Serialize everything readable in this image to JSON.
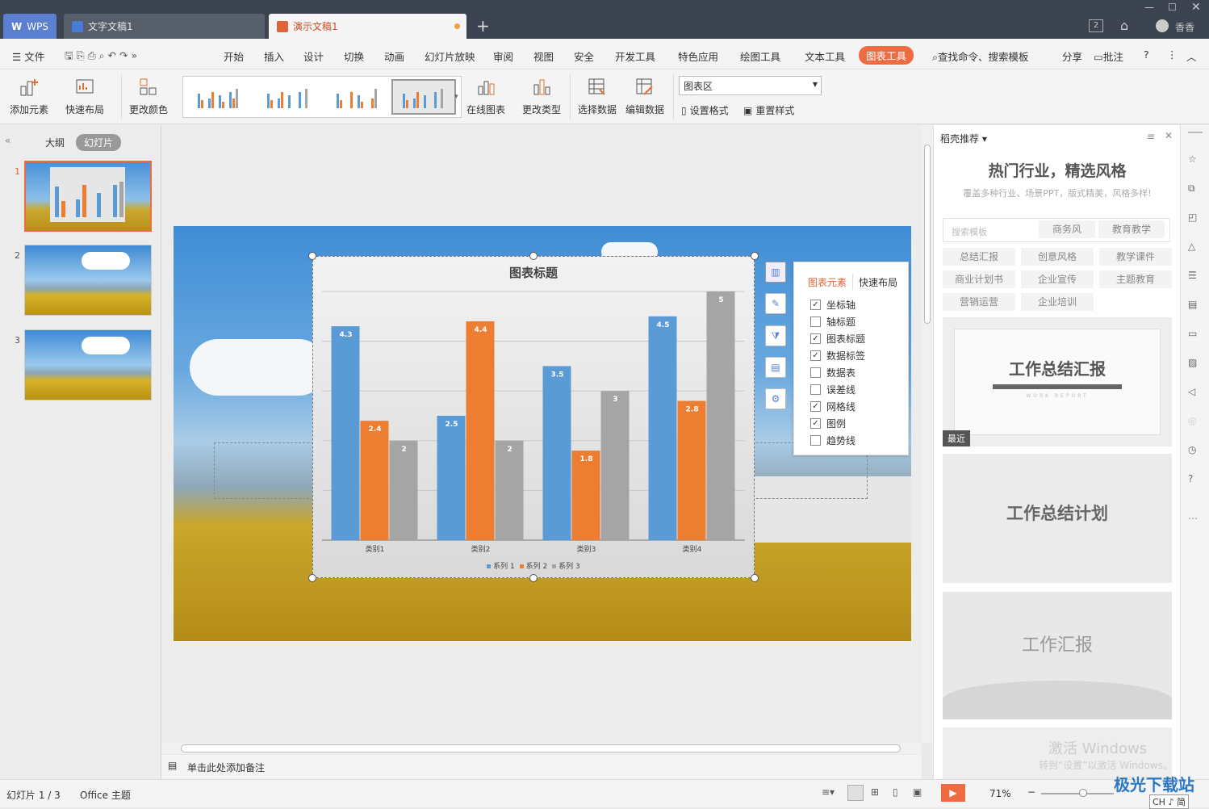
{
  "titlebar": {
    "tabs": [
      {
        "label": "WPS"
      },
      {
        "label": "文字文稿1"
      },
      {
        "label": "演示文稿1"
      }
    ],
    "badge": "2",
    "user": "香香"
  },
  "menubar": {
    "file": "文件",
    "items": [
      "开始",
      "插入",
      "设计",
      "切换",
      "动画",
      "幻灯片放映",
      "审阅",
      "视图",
      "安全",
      "开发工具",
      "特色应用",
      "绘图工具",
      "文本工具",
      "图表工具"
    ],
    "search": "查找命令、搜索模板",
    "share": "分享",
    "comment": "批注"
  },
  "ribbon": {
    "add_element": "添加元素",
    "quick_layout": "快速布局",
    "change_color": "更改颜色",
    "online_chart": "在线图表",
    "change_type": "更改类型",
    "select_data": "选择数据",
    "edit_data": "编辑数据",
    "chart_area": "图表区",
    "set_format": "设置格式",
    "reset_style": "重置样式"
  },
  "leftpane": {
    "outline": "大纲",
    "slides": "幻灯片",
    "slide_numbers": [
      "1",
      "2",
      "3"
    ]
  },
  "chart_data": {
    "type": "bar",
    "title": "图表标题",
    "categories": [
      "类别1",
      "类别2",
      "类别3",
      "类别4"
    ],
    "series": [
      {
        "name": "系列 1",
        "values": [
          4.3,
          2.5,
          3.5,
          4.5
        ],
        "color": "#5b9bd5"
      },
      {
        "name": "系列 2",
        "values": [
          2.4,
          4.4,
          1.8,
          2.8
        ],
        "color": "#ed7d31"
      },
      {
        "name": "系列 3",
        "values": [
          2,
          2,
          3,
          5
        ],
        "color": "#a5a5a5"
      }
    ],
    "ylim": [
      0,
      5
    ],
    "grid": true,
    "legend": "bottom"
  },
  "elements_panel": {
    "tab1": "图表元素",
    "tab2": "快速布局",
    "items": [
      {
        "label": "坐标轴",
        "checked": true
      },
      {
        "label": "轴标题",
        "checked": false
      },
      {
        "label": "图表标题",
        "checked": true
      },
      {
        "label": "数据标签",
        "checked": true
      },
      {
        "label": "数据表",
        "checked": false
      },
      {
        "label": "误差线",
        "checked": false
      },
      {
        "label": "网格线",
        "checked": true
      },
      {
        "label": "图例",
        "checked": true
      },
      {
        "label": "趋势线",
        "checked": false
      }
    ]
  },
  "rightpanel": {
    "header": "稻壳推荐",
    "title": "热门行业，精选风格",
    "subtitle": "覆盖多种行业、场景PPT，版式精美，风格多样!",
    "search_placeholder": "搜索模板",
    "tags": [
      "商务风",
      "教育教学",
      "总结汇报",
      "创意风格",
      "教学课件",
      "商业计划书",
      "企业宣传",
      "主题教育",
      "营销运营",
      "企业培训"
    ],
    "templates": [
      {
        "title": "工作总结汇报",
        "sub": "WORK REPORT",
        "badge": "最近"
      },
      {
        "title": "工作总结计划"
      },
      {
        "title": "工作汇报"
      }
    ],
    "watermark1": "激活 Windows",
    "watermark2": "转到“设置”以激活 Windows。"
  },
  "notes": "单击此处添加备注",
  "statusbar": {
    "slide": "幻灯片 1 / 3",
    "theme": "Office 主题",
    "zoom": "71%",
    "ime": "CH ♪ 简",
    "site": "极光下载站"
  }
}
